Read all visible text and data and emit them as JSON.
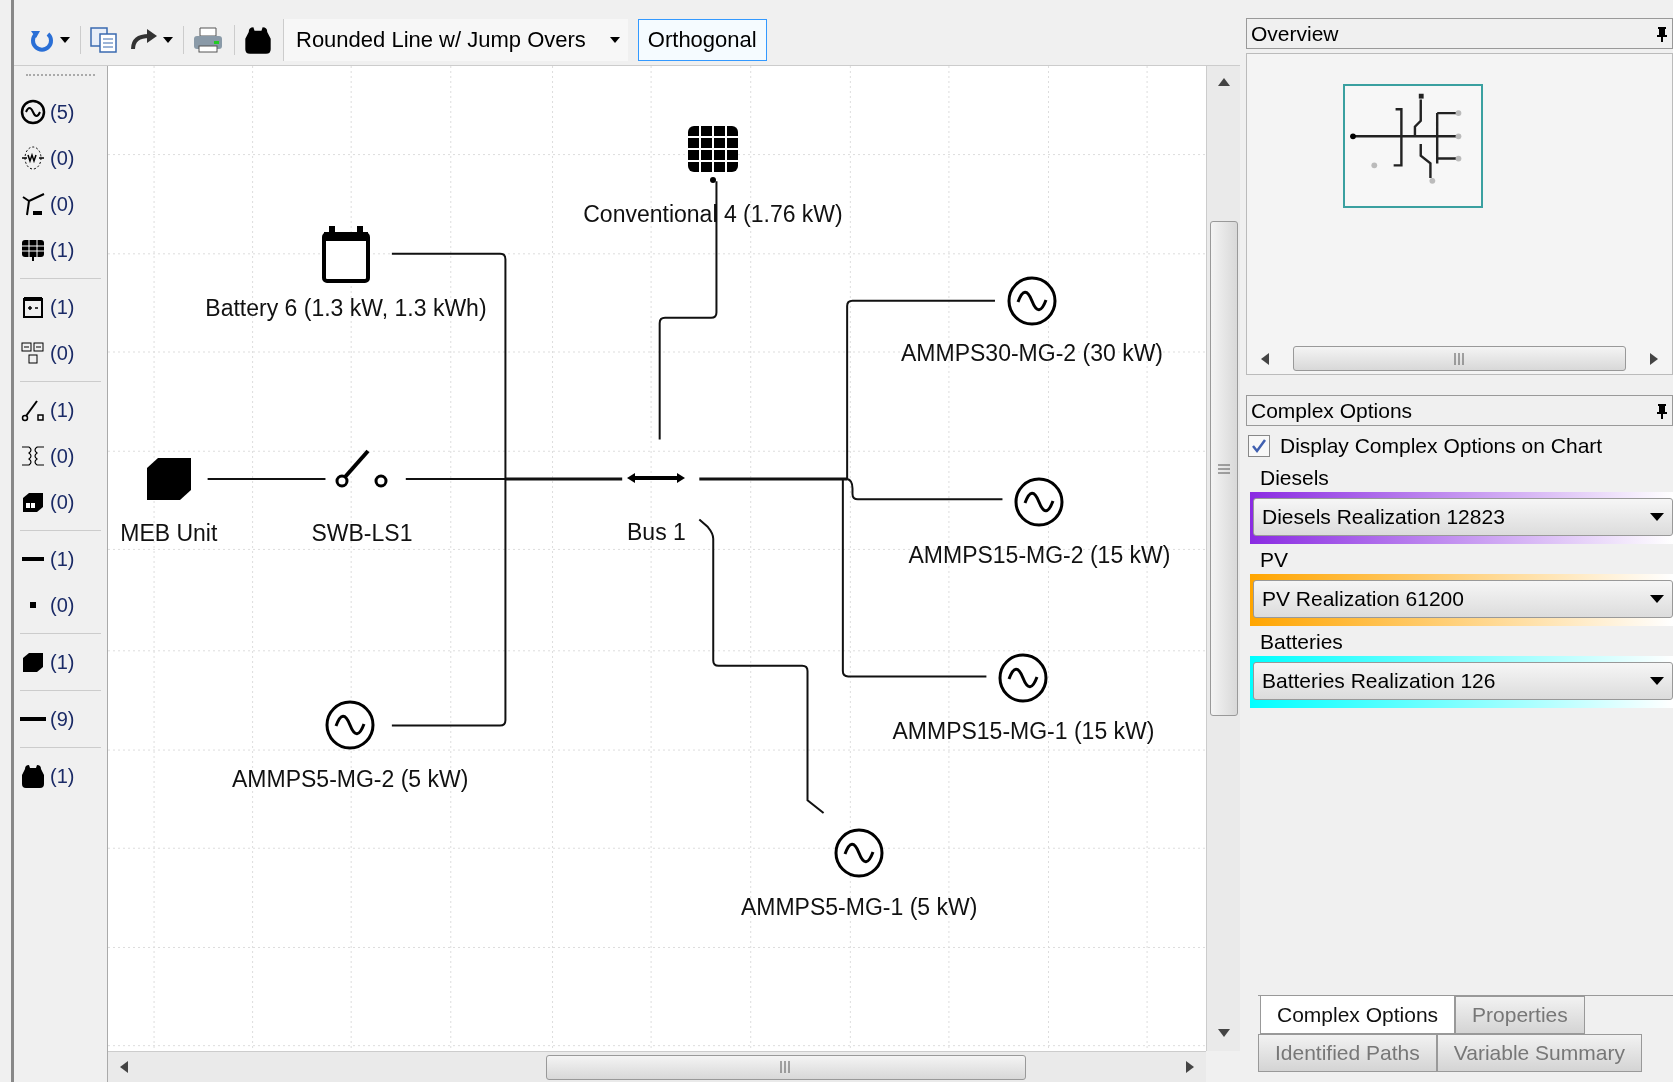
{
  "toolbar": {
    "line_style": "Rounded Line w/ Jump Overs",
    "routing": {
      "label": "Orthogonal",
      "selected": true
    }
  },
  "palette": [
    [
      {
        "kind": "ac-source",
        "count": "(5)"
      },
      {
        "kind": "diesel",
        "count": "(0)"
      },
      {
        "kind": "wind",
        "count": "(0)"
      },
      {
        "kind": "solar",
        "count": "(1)"
      }
    ],
    [
      {
        "kind": "battery",
        "count": "(1)"
      },
      {
        "kind": "converter",
        "count": "(0)"
      }
    ],
    [
      {
        "kind": "switch",
        "count": "(1)"
      },
      {
        "kind": "transformer",
        "count": "(0)"
      },
      {
        "kind": "meter",
        "count": "(0)"
      }
    ],
    [
      {
        "kind": "bus",
        "count": "(1)"
      },
      {
        "kind": "node",
        "count": "(0)"
      }
    ],
    [
      {
        "kind": "load",
        "count": "(1)"
      }
    ],
    [
      {
        "kind": "line",
        "count": "(9)"
      }
    ],
    [
      {
        "kind": "vehicle",
        "count": "(1)"
      }
    ]
  ],
  "diagram": {
    "nodes": [
      {
        "kind": "solar",
        "label": "Conventional 4 (1.76 kW)"
      },
      {
        "kind": "battery",
        "label": "Battery 6 (1.3 kW, 1.3 kWh)"
      },
      {
        "kind": "load",
        "label": "MEB Unit"
      },
      {
        "kind": "switch",
        "label": "SWB-LS1"
      },
      {
        "kind": "bus",
        "label": "Bus 1"
      },
      {
        "kind": "ac-source",
        "label": "AMMPS30-MG-2 (30 kW)"
      },
      {
        "kind": "ac-source",
        "label": "AMMPS15-MG-2 (15 kW)"
      },
      {
        "kind": "ac-source",
        "label": "AMMPS15-MG-1 (15 kW)"
      },
      {
        "kind": "ac-source",
        "label": "AMMPS5-MG-1 (5 kW)"
      },
      {
        "kind": "ac-source",
        "label": "AMMPS5-MG-2 (5 kW)"
      }
    ]
  },
  "overview": {
    "title": "Overview"
  },
  "complex_options": {
    "title": "Complex Options",
    "display_on_chart": {
      "label": "Display Complex Options on Chart",
      "checked": true
    },
    "groups": [
      {
        "title": "Diesels",
        "value": "Diesels Realization 12823",
        "color": "#8a2be2"
      },
      {
        "title": "PV",
        "value": "PV Realization 61200",
        "color": "#ffa500"
      },
      {
        "title": "Batteries",
        "value": "Batteries Realization 126",
        "color": "#00ffff"
      }
    ]
  },
  "bottom_tabs": [
    [
      {
        "label": "Complex Options",
        "selected": true
      },
      {
        "label": "Properties",
        "selected": false
      }
    ],
    [
      {
        "label": "Identified Paths",
        "selected": false
      },
      {
        "label": "Variable Summary",
        "selected": false
      }
    ]
  ]
}
